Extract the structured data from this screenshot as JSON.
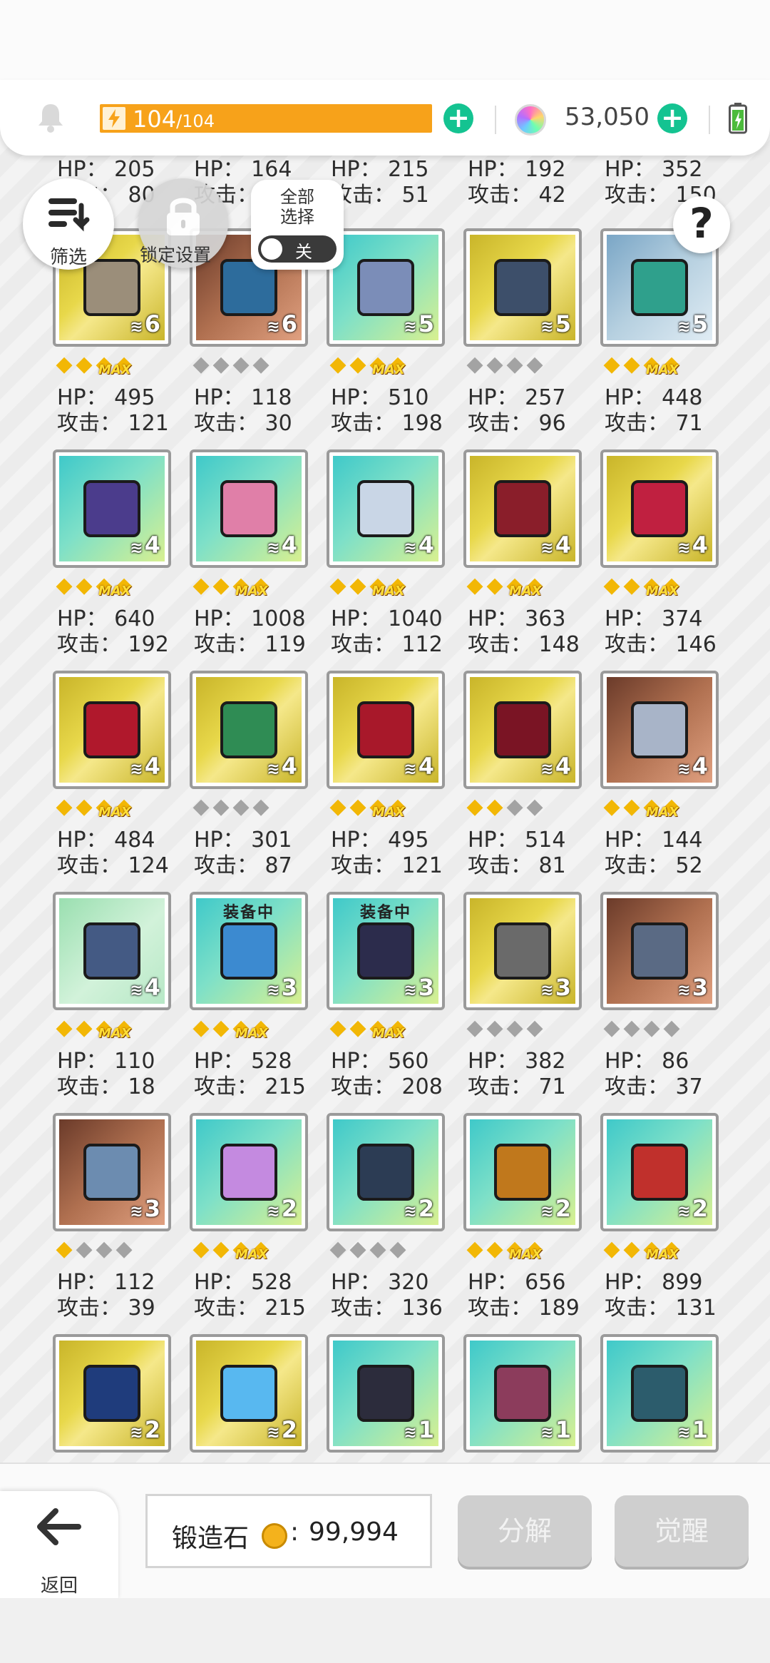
{
  "topbar": {
    "energy_current": "104",
    "energy_max": "/104",
    "energy_fill": 1.0,
    "gems": "53,050"
  },
  "controls": {
    "filter_label": "筛选",
    "lock_label": "锁定设置",
    "select_all_line1": "全部",
    "select_all_line2": "选择",
    "toggle_state": "关",
    "help_label": "?"
  },
  "colors": {
    "energy": "#f7a21a",
    "add_button": "#14c391",
    "star_on": "#f2b705",
    "star_off": "#a3a3a3"
  },
  "items": [
    {
      "hp": "HP： 205",
      "atk": "攻击： 80",
      "count": "",
      "stars": 0,
      "max": false,
      "partial": true
    },
    {
      "hp": "HP： 164",
      "atk": "攻击： 55",
      "count": "",
      "stars": 0,
      "max": false,
      "partial": true
    },
    {
      "hp": "HP： 215",
      "atk": "攻击： 51",
      "count": "",
      "stars": 0,
      "max": false,
      "partial": true
    },
    {
      "hp": "HP： 192",
      "atk": "攻击： 42",
      "count": "",
      "stars": 0,
      "max": false,
      "partial": true
    },
    {
      "hp": "HP： 352",
      "atk": "攻击： 150",
      "count": "",
      "stars": 0,
      "max": false,
      "partial": true
    },
    {
      "hp": "HP： 495",
      "atk": "攻击： 121",
      "count": "6",
      "stars": 4,
      "max": true,
      "art": "gold",
      "icon": "book-icon",
      "color": "#9b8e7a"
    },
    {
      "hp": "HP： 118",
      "atk": "攻击： 30",
      "count": "6",
      "stars": 0,
      "max": false,
      "art": "brown",
      "icon": "gauntlet-icon",
      "color": "#2d6c9c"
    },
    {
      "hp": "HP： 510",
      "atk": "攻击： 198",
      "count": "5",
      "stars": 4,
      "max": true,
      "art": "teal",
      "icon": "sword-icon",
      "color": "#7b8db8"
    },
    {
      "hp": "HP： 257",
      "atk": "攻击： 96",
      "count": "5",
      "stars": 0,
      "max": false,
      "art": "gold",
      "icon": "spear-icon",
      "color": "#3d4f6a"
    },
    {
      "hp": "HP： 448",
      "atk": "攻击： 71",
      "count": "5",
      "stars": 4,
      "max": true,
      "art": "steel",
      "icon": "star-shuriken-icon",
      "color": "#2fa08c"
    },
    {
      "hp": "HP： 640",
      "atk": "攻击： 192",
      "count": "4",
      "stars": 4,
      "max": true,
      "art": "teal",
      "icon": "tome-icon",
      "color": "#4b3c8c"
    },
    {
      "hp": "HP： 1008",
      "atk": "攻击： 119",
      "count": "4",
      "stars": 4,
      "max": true,
      "art": "teal",
      "icon": "crystal-icon",
      "color": "#e07fa8"
    },
    {
      "hp": "HP： 1040",
      "atk": "攻击： 112",
      "count": "4",
      "stars": 4,
      "max": true,
      "art": "teal",
      "icon": "scroll-icon",
      "color": "#c9d6e6"
    },
    {
      "hp": "HP： 363",
      "atk": "攻击： 148",
      "count": "4",
      "stars": 4,
      "max": true,
      "art": "gold",
      "icon": "scythe-icon",
      "color": "#8a1e2a"
    },
    {
      "hp": "HP： 374",
      "atk": "攻击： 146",
      "count": "4",
      "stars": 4,
      "max": true,
      "art": "gold",
      "icon": "star-wand-icon",
      "color": "#c02040"
    },
    {
      "hp": "HP： 484",
      "atk": "攻击： 124",
      "count": "4",
      "stars": 4,
      "max": true,
      "art": "gold",
      "icon": "bow-icon",
      "color": "#b0182c"
    },
    {
      "hp": "HP： 301",
      "atk": "攻击： 87",
      "count": "4",
      "stars": 0,
      "max": false,
      "art": "gold",
      "icon": "vine-bow-icon",
      "color": "#2f8c54"
    },
    {
      "hp": "HP： 495",
      "atk": "攻击： 121",
      "count": "4",
      "stars": 4,
      "max": true,
      "art": "gold",
      "icon": "chest-icon",
      "color": "#a8182a"
    },
    {
      "hp": "HP： 514",
      "atk": "攻击： 81",
      "count": "4",
      "stars": 2,
      "max": false,
      "art": "gold",
      "icon": "shield-round-icon",
      "color": "#7a1424"
    },
    {
      "hp": "HP： 144",
      "atk": "攻击： 52",
      "count": "4",
      "stars": 4,
      "max": true,
      "art": "brown",
      "icon": "short-sword-icon",
      "color": "#a8b4c8"
    },
    {
      "hp": "HP： 110",
      "atk": "攻击： 18",
      "count": "4",
      "stars": 4,
      "max": true,
      "art": "mint",
      "icon": "shield-icon",
      "color": "#445a84"
    },
    {
      "hp": "HP： 528",
      "atk": "攻击： 215",
      "count": "3",
      "stars": 4,
      "max": true,
      "art": "teal",
      "icon": "sword-icon",
      "color": "#3c8ad0",
      "equipped": "装备中"
    },
    {
      "hp": "HP： 560",
      "atk": "攻击： 208",
      "count": "3",
      "stars": 4,
      "max": true,
      "art": "teal",
      "icon": "medallion-icon",
      "color": "#2c2c4c",
      "equipped": "装备中"
    },
    {
      "hp": "HP： 382",
      "atk": "攻击： 71",
      "count": "3",
      "stars": 0,
      "max": false,
      "art": "gold",
      "icon": "tablet-icon",
      "color": "#6a6a6a"
    },
    {
      "hp": "HP： 86",
      "atk": "攻击： 37",
      "count": "3",
      "stars": 0,
      "max": false,
      "art": "brown",
      "icon": "axe-icon",
      "color": "#5a6a84"
    },
    {
      "hp": "HP： 112",
      "atk": "攻击： 39",
      "count": "3",
      "stars": 1,
      "max": false,
      "art": "brown",
      "icon": "lance-icon",
      "color": "#6c8cb0"
    },
    {
      "hp": "HP： 528",
      "atk": "攻击： 215",
      "count": "2",
      "stars": 4,
      "max": true,
      "art": "teal",
      "icon": "rainbow-sword-icon",
      "color": "#c48ae0"
    },
    {
      "hp": "HP： 320",
      "atk": "攻击： 136",
      "count": "2",
      "stars": 0,
      "max": false,
      "art": "teal",
      "icon": "pickaxe-icon",
      "color": "#2c3c54"
    },
    {
      "hp": "HP： 656",
      "atk": "攻击： 189",
      "count": "2",
      "stars": 4,
      "max": true,
      "art": "teal",
      "icon": "grimoire-icon",
      "color": "#c0781c"
    },
    {
      "hp": "HP： 899",
      "atk": "攻击： 131",
      "count": "2",
      "stars": 4,
      "max": true,
      "art": "teal",
      "icon": "wreath-icon",
      "color": "#c0302c"
    },
    {
      "hp": "",
      "atk": "",
      "count": "2",
      "stars": 0,
      "max": false,
      "art": "gold",
      "icon": "bell-book-icon",
      "color": "#1f3c7c"
    },
    {
      "hp": "",
      "atk": "",
      "count": "2",
      "stars": 0,
      "max": false,
      "art": "gold",
      "icon": "diamond-icon",
      "color": "#58b8f0"
    },
    {
      "hp": "",
      "atk": "",
      "count": "1",
      "stars": 0,
      "max": false,
      "art": "teal",
      "icon": "dark-bow-icon",
      "color": "#2c2c3c"
    },
    {
      "hp": "",
      "atk": "",
      "count": "1",
      "stars": 0,
      "max": false,
      "art": "teal",
      "icon": "bag-icon",
      "color": "#8c3c5c"
    },
    {
      "hp": "",
      "atk": "",
      "count": "1",
      "stars": 0,
      "max": false,
      "art": "teal",
      "icon": "cabinet-icon",
      "color": "#2c5c6c"
    }
  ],
  "bottom": {
    "back_label": "返回",
    "stone_label": "锻造石",
    "stone_colon": ":",
    "stone_value": "99,994",
    "dismantle_label": "分解",
    "awaken_label": "觉醒"
  }
}
